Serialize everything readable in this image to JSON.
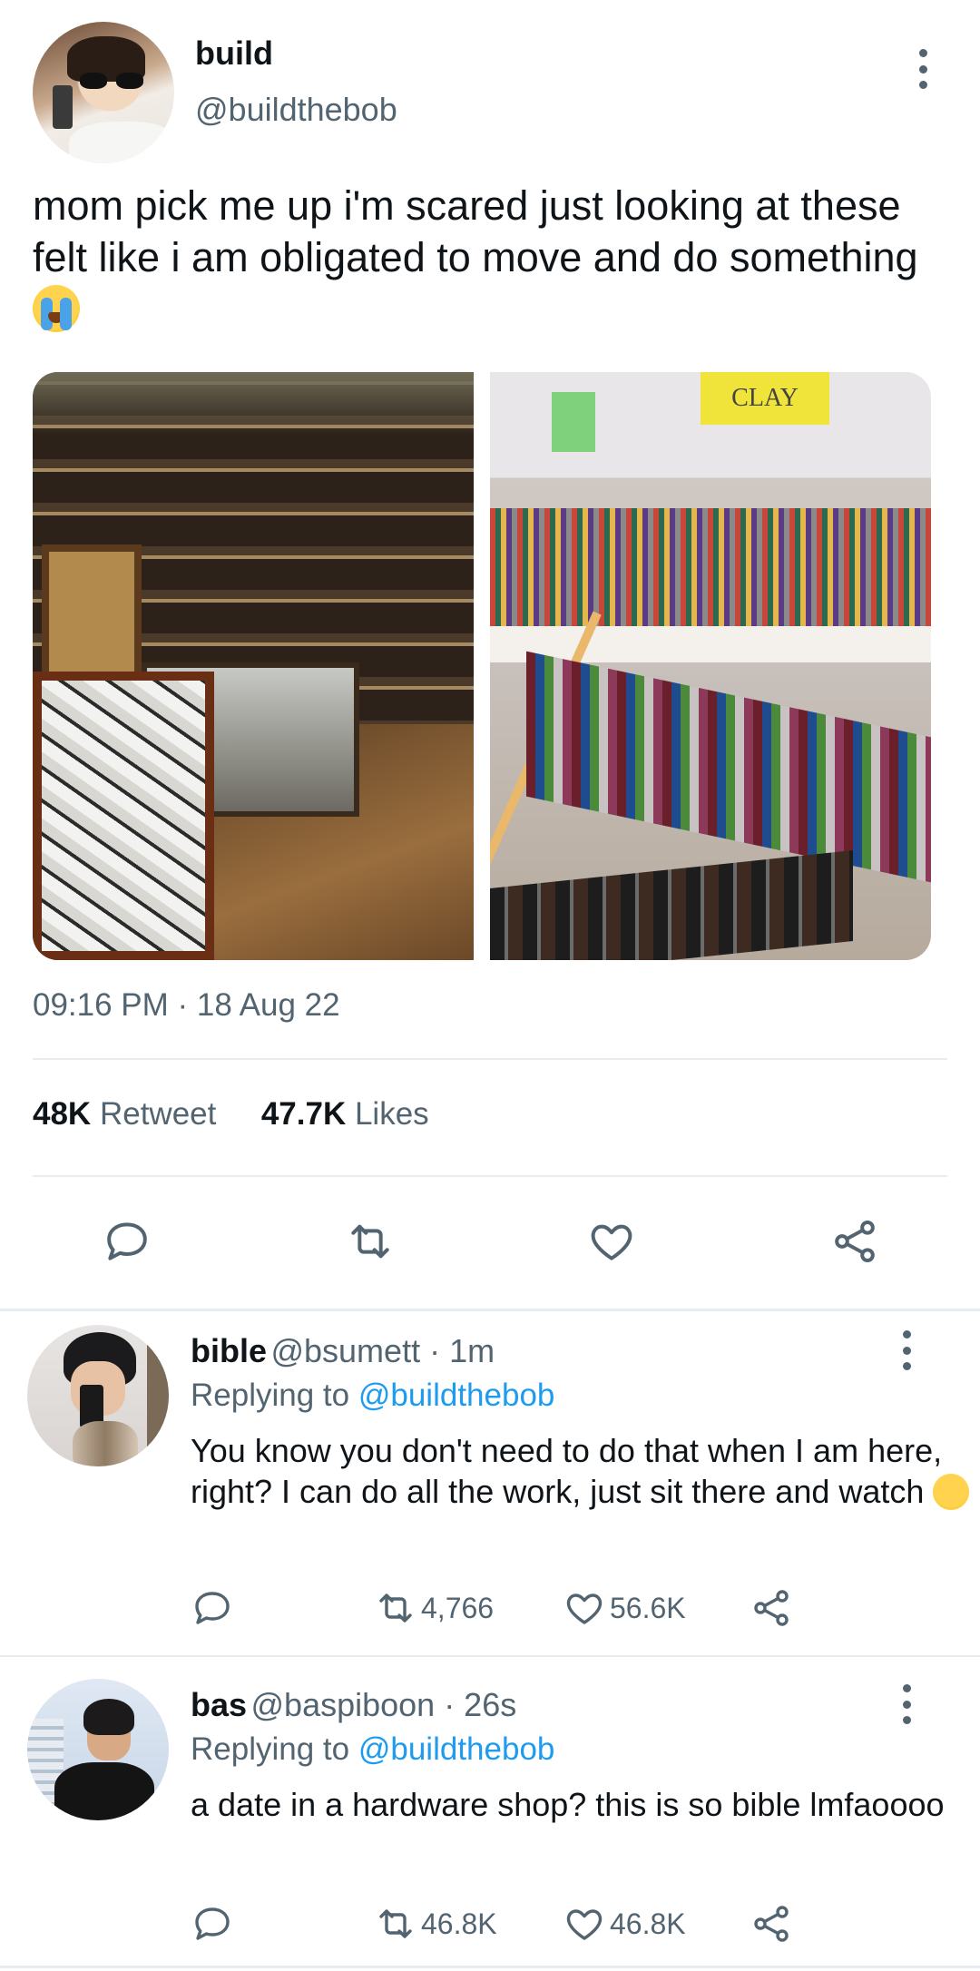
{
  "tweet": {
    "author": {
      "display_name": "build",
      "handle": "@buildthebob"
    },
    "text": "mom pick me up i'm scared just looking at these felt like i am obligated to move and do something",
    "text_emoji": "loudly-crying-face",
    "media": [
      {
        "alt_icon": "photo-hardware-store"
      },
      {
        "alt_icon": "photo-bead-shop",
        "sign_text": "CLAY"
      }
    ],
    "timestamp": "09:16 PM · 18 Aug 22",
    "stats": {
      "retweets_value": "48K",
      "retweets_label": "Retweet",
      "likes_value": "47.7K",
      "likes_label": "Likes"
    },
    "actions": [
      "reply-icon",
      "retweet-icon",
      "like-icon",
      "share-icon"
    ]
  },
  "replies": [
    {
      "display_name": "bible",
      "meta": "@bsumett · 1m",
      "replying_prefix": "Replying to",
      "replying_handle": "@buildthebob",
      "text": "You know you don't need to do that when I am here, right? I can do all the work, just sit there and watch",
      "text_emoji": "face-with-tears-of-joy",
      "retweets": "4,766",
      "likes": "56.6K"
    },
    {
      "display_name": "bas",
      "meta": "@baspiboon · 26s",
      "replying_prefix": "Replying to",
      "replying_handle": "@buildthebob",
      "text": "a date in a hardware shop? this is so bible lmfaoooo",
      "retweets": "46.8K",
      "likes": "46.8K"
    }
  ],
  "colors": {
    "text": "#0f1419",
    "secondary": "#536471",
    "link": "#1d9bf0",
    "divider": "#e6ecf0"
  }
}
